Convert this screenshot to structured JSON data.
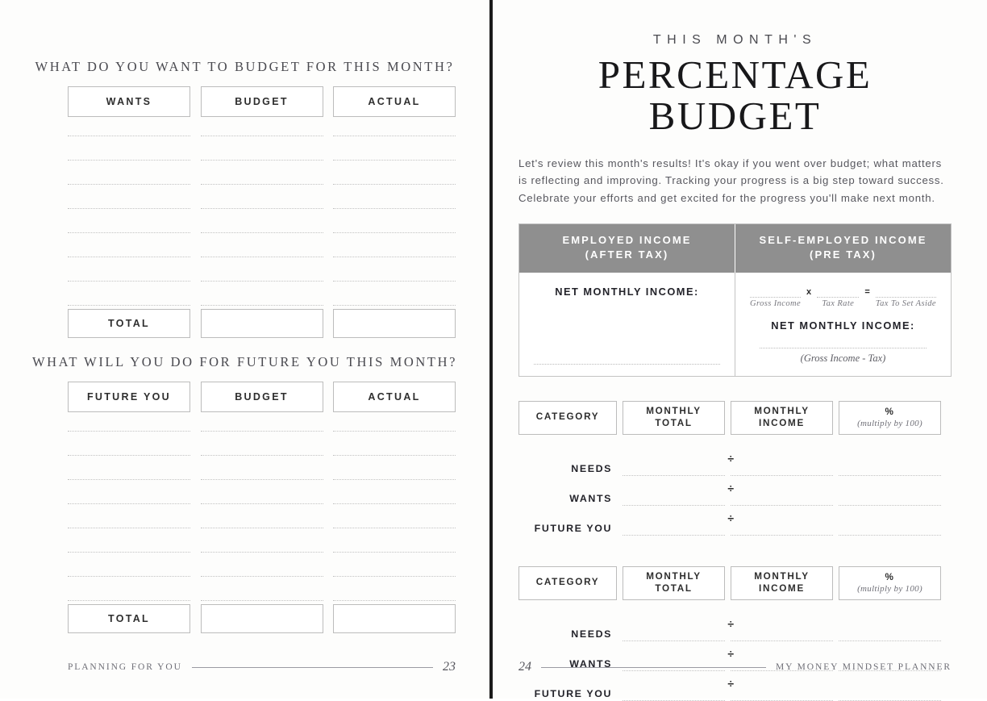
{
  "left_page": {
    "section1": {
      "title": "WHAT DO YOU WANT TO BUDGET FOR THIS MONTH?",
      "headers": [
        "WANTS",
        "BUDGET",
        "ACTUAL"
      ],
      "line_count": 8,
      "total_label": "TOTAL"
    },
    "section2": {
      "title": "WHAT WILL YOU DO FOR FUTURE YOU THIS MONTH?",
      "headers": [
        "FUTURE YOU",
        "BUDGET",
        "ACTUAL"
      ],
      "line_count": 8,
      "total_label": "TOTAL"
    },
    "footer": {
      "label": "PLANNING FOR YOU",
      "page_number": "23"
    }
  },
  "right_page": {
    "eyebrow": "THIS MONTH'S",
    "title": "PERCENTAGE BUDGET",
    "intro": "Let's review this month's results! It's okay if you went over budget; what matters is reflecting and improving. Tracking your progress is a big step toward success. Celebrate your efforts and get excited for the progress you'll make next month.",
    "income_table": {
      "header_left_line1": "EMPLOYED INCOME",
      "header_left_line2": "(AFTER TAX)",
      "header_right_line1": "SELF-EMPLOYED INCOME",
      "header_right_line2": "(PRE TAX)",
      "employed_label": "NET MONTHLY INCOME:",
      "formula": {
        "captions": [
          "Gross Income",
          "Tax Rate",
          "Tax To Set Aside"
        ],
        "operator_multiply": "x",
        "operator_equals": "="
      },
      "self_employed_label": "NET MONTHLY INCOME:",
      "self_employed_note": "(Gross Income - Tax)"
    },
    "percentage_table_1": {
      "headers": {
        "category": "CATEGORY",
        "monthly_total_line1": "MONTHLY",
        "monthly_total_line2": "TOTAL",
        "monthly_income_line1": "MONTHLY",
        "monthly_income_line2": "INCOME",
        "percent_symbol": "%",
        "percent_note": "(multiply by 100)"
      },
      "rows": [
        "NEEDS",
        "WANTS",
        "FUTURE YOU"
      ],
      "divide_symbol": "÷"
    },
    "percentage_table_2": {
      "headers": {
        "category": "CATEGORY",
        "monthly_total_line1": "MONTHLY",
        "monthly_total_line2": "TOTAL",
        "monthly_income_line1": "MONTHLY",
        "monthly_income_line2": "INCOME",
        "percent_symbol": "%",
        "percent_note": "(multiply by 100)"
      },
      "rows": [
        "NEEDS",
        "WANTS",
        "FUTURE YOU"
      ],
      "divide_symbol": "÷"
    },
    "footer": {
      "label": "MY MONEY MINDSET PLANNER",
      "page_number": "24"
    }
  },
  "colors": {
    "header_band": "#8f8f8f",
    "spine": "#1b1b1b",
    "text_dark": "#23232a",
    "text_muted": "#57575e",
    "border": "#bcbcbc",
    "dotted": "#c2c2c2"
  }
}
